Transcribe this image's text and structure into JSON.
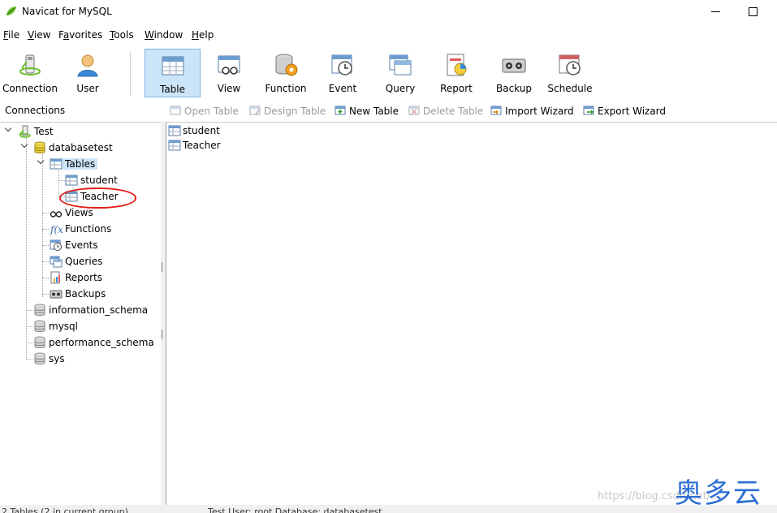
{
  "window": {
    "title": "Navicat for MySQL"
  },
  "menu": [
    {
      "pre": "",
      "key": "F",
      "post": "ile"
    },
    {
      "pre": "",
      "key": "V",
      "post": "iew"
    },
    {
      "pre": "F",
      "key": "a",
      "post": "vorites"
    },
    {
      "pre": "",
      "key": "T",
      "post": "ools"
    },
    {
      "pre": "",
      "key": "W",
      "post": "indow"
    },
    {
      "pre": "",
      "key": "H",
      "post": "elp"
    }
  ],
  "toolbar": {
    "connection": "Connection",
    "user": "User",
    "table": "Table",
    "view": "View",
    "function": "Function",
    "event": "Event",
    "query": "Query",
    "report": "Report",
    "backup": "Backup",
    "schedule": "Schedule"
  },
  "connections_header": "Connections",
  "object_toolbar": {
    "open_table": "Open Table",
    "design_table": "Design Table",
    "new_table": "New Table",
    "delete_table": "Delete Table",
    "import_wizard": "Import Wizard",
    "export_wizard": "Export Wizard"
  },
  "tree": {
    "connection": "Test",
    "database": "databasetest",
    "tables": "Tables",
    "table_items": [
      "student",
      "Teacher"
    ],
    "views": "Views",
    "functions": "Functions",
    "events": "Events",
    "queries": "Queries",
    "reports": "Reports",
    "backups": "Backups",
    "other_databases": [
      "information_schema",
      "mysql",
      "performance_schema",
      "sys"
    ]
  },
  "object_list": [
    "student",
    "Teacher"
  ],
  "statusbar": {
    "left": "2 Tables (2 in current group)",
    "right": "Test  User: root  Database: databasetest"
  },
  "watermark": {
    "cn": "奥多云",
    "url": "https://blog.csdn.net/..."
  },
  "colors": {
    "selection": "#cce4f7",
    "highlight": "#e0201a",
    "watermark": "#2c6fd4"
  }
}
